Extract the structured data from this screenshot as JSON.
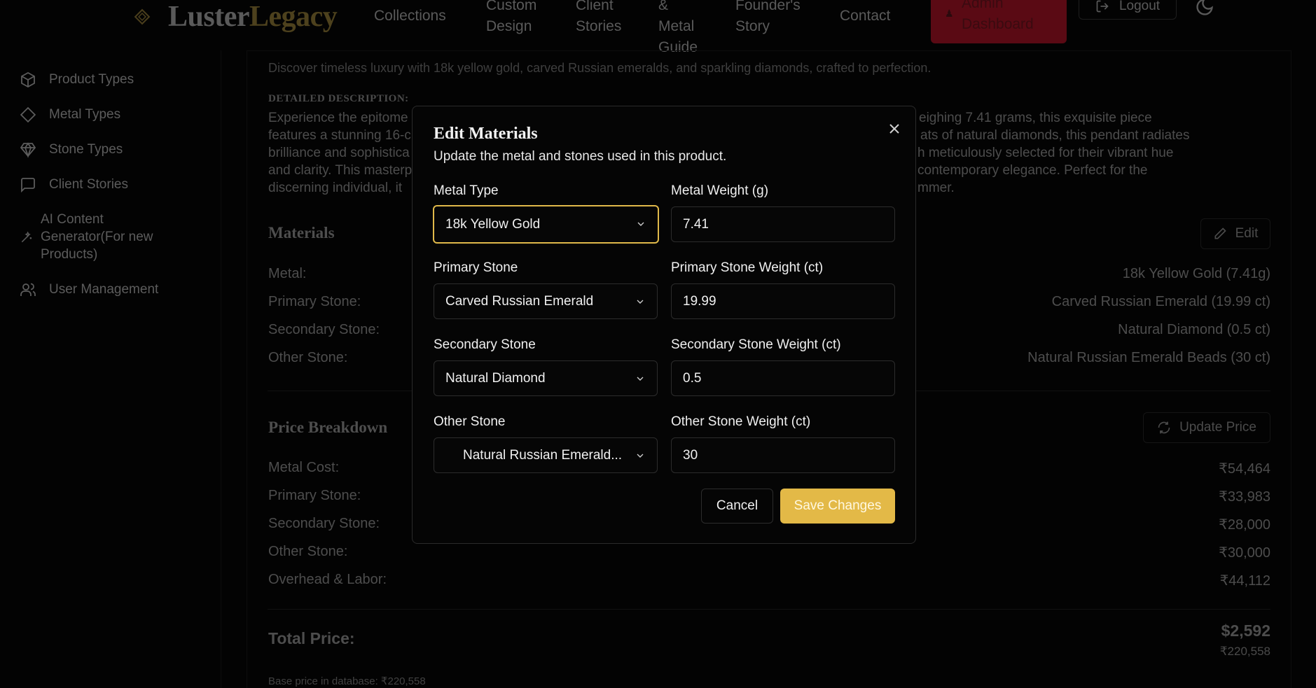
{
  "colors": {
    "accent_gold": "#e3b947",
    "focus_ring": "#e0b94a",
    "admin_red": "#5a0a14",
    "background": "#030303"
  },
  "header": {
    "logo": {
      "part1": "Luster",
      "part2": "Legacy",
      "icon": "diamond-outline-icon"
    },
    "nav": {
      "collections": "Collections",
      "custom_design_1": "Custom",
      "custom_design_2": "Design",
      "client_stories_1": "Client",
      "client_stories_2": "Stories",
      "metal_guide_1": "&",
      "metal_guide_2": "Metal",
      "metal_guide_3": "Guide",
      "founders_1": "Founder's",
      "founders_2": "Story",
      "contact": "Contact"
    },
    "admin": {
      "line1": "Admin",
      "line2": "Dashboard"
    },
    "logout": "Logout",
    "theme_icon": "moon-icon"
  },
  "sidebar": {
    "items": [
      {
        "label": "Product Types",
        "icon": "box-icon"
      },
      {
        "label": "Metal Types",
        "icon": "diamond-shape-icon"
      },
      {
        "label": "Stone Types",
        "icon": "gem-icon"
      },
      {
        "label": "Client Stories",
        "icon": "message-square-icon"
      },
      {
        "label_1": "AI Content",
        "label_2": "Generator(For new",
        "label_3": "Products)",
        "icon": "wand-icon"
      },
      {
        "label": "User Management",
        "icon": "users-icon"
      }
    ]
  },
  "product": {
    "short_description": "Discover timeless luxury with 18k yellow gold, carved Russian emeralds, and sparkling diamonds, crafted to perfection.",
    "detailed_heading": "DETAILED DESCRIPTION:",
    "detailed_left": [
      "Experience the epitome",
      "features a stunning 16-c",
      "brilliance and sophistica",
      "and clarity. This masterp",
      "discerning individual, it"
    ],
    "detailed_right": [
      "eighing 7.41 grams, this exquisite piece",
      "ats of natural diamonds, this pendant radiates",
      "h meticulously selected for their vibrant hue",
      "contemporary elegance. Perfect for the",
      "mmer."
    ]
  },
  "materials": {
    "title": "Materials",
    "edit_label": "Edit",
    "rows": [
      {
        "label": "Metal:",
        "value": "18k Yellow Gold (7.41g)"
      },
      {
        "label": "Primary Stone:",
        "value": "Carved Russian Emerald (19.99 ct)"
      },
      {
        "label": "Secondary Stone:",
        "value": "Natural Diamond (0.5 ct)"
      },
      {
        "label": "Other Stone:",
        "value": "Natural Russian Emerald Beads (30 ct)"
      }
    ]
  },
  "price": {
    "title": "Price Breakdown",
    "update_label": "Update Price",
    "rows": [
      {
        "label": "Metal Cost:",
        "value": "₹54,464"
      },
      {
        "label": "Primary Stone:",
        "value": "₹33,983"
      },
      {
        "label": "Secondary Stone:",
        "value": "₹28,000"
      },
      {
        "label": "Other Stone:",
        "value": "₹30,000"
      },
      {
        "label": "Overhead & Labor:",
        "value": "₹44,112"
      }
    ],
    "total_label": "Total Price:",
    "total_usd": "$2,592",
    "total_inr": "₹220,558",
    "base_price_note": "Base price in database: ₹220,558"
  },
  "modal": {
    "title": "Edit Materials",
    "subtitle": "Update the metal and stones used in this product.",
    "fields": {
      "metal_type": {
        "label": "Metal Type",
        "value": "18k Yellow Gold"
      },
      "metal_weight": {
        "label": "Metal Weight (g)",
        "value": "7.41"
      },
      "primary_stone": {
        "label": "Primary Stone",
        "value": "Carved Russian Emerald"
      },
      "primary_stone_weight": {
        "label": "Primary Stone Weight (ct)",
        "value": "19.99"
      },
      "secondary_stone": {
        "label": "Secondary Stone",
        "value": "Natural Diamond"
      },
      "secondary_stone_weight": {
        "label": "Secondary Stone Weight (ct)",
        "value": "0.5"
      },
      "other_stone": {
        "label": "Other Stone",
        "value": "Natural Russian Emerald..."
      },
      "other_stone_weight": {
        "label": "Other Stone Weight (ct)",
        "value": "30"
      }
    },
    "cancel_label": "Cancel",
    "save_label": "Save Changes"
  }
}
